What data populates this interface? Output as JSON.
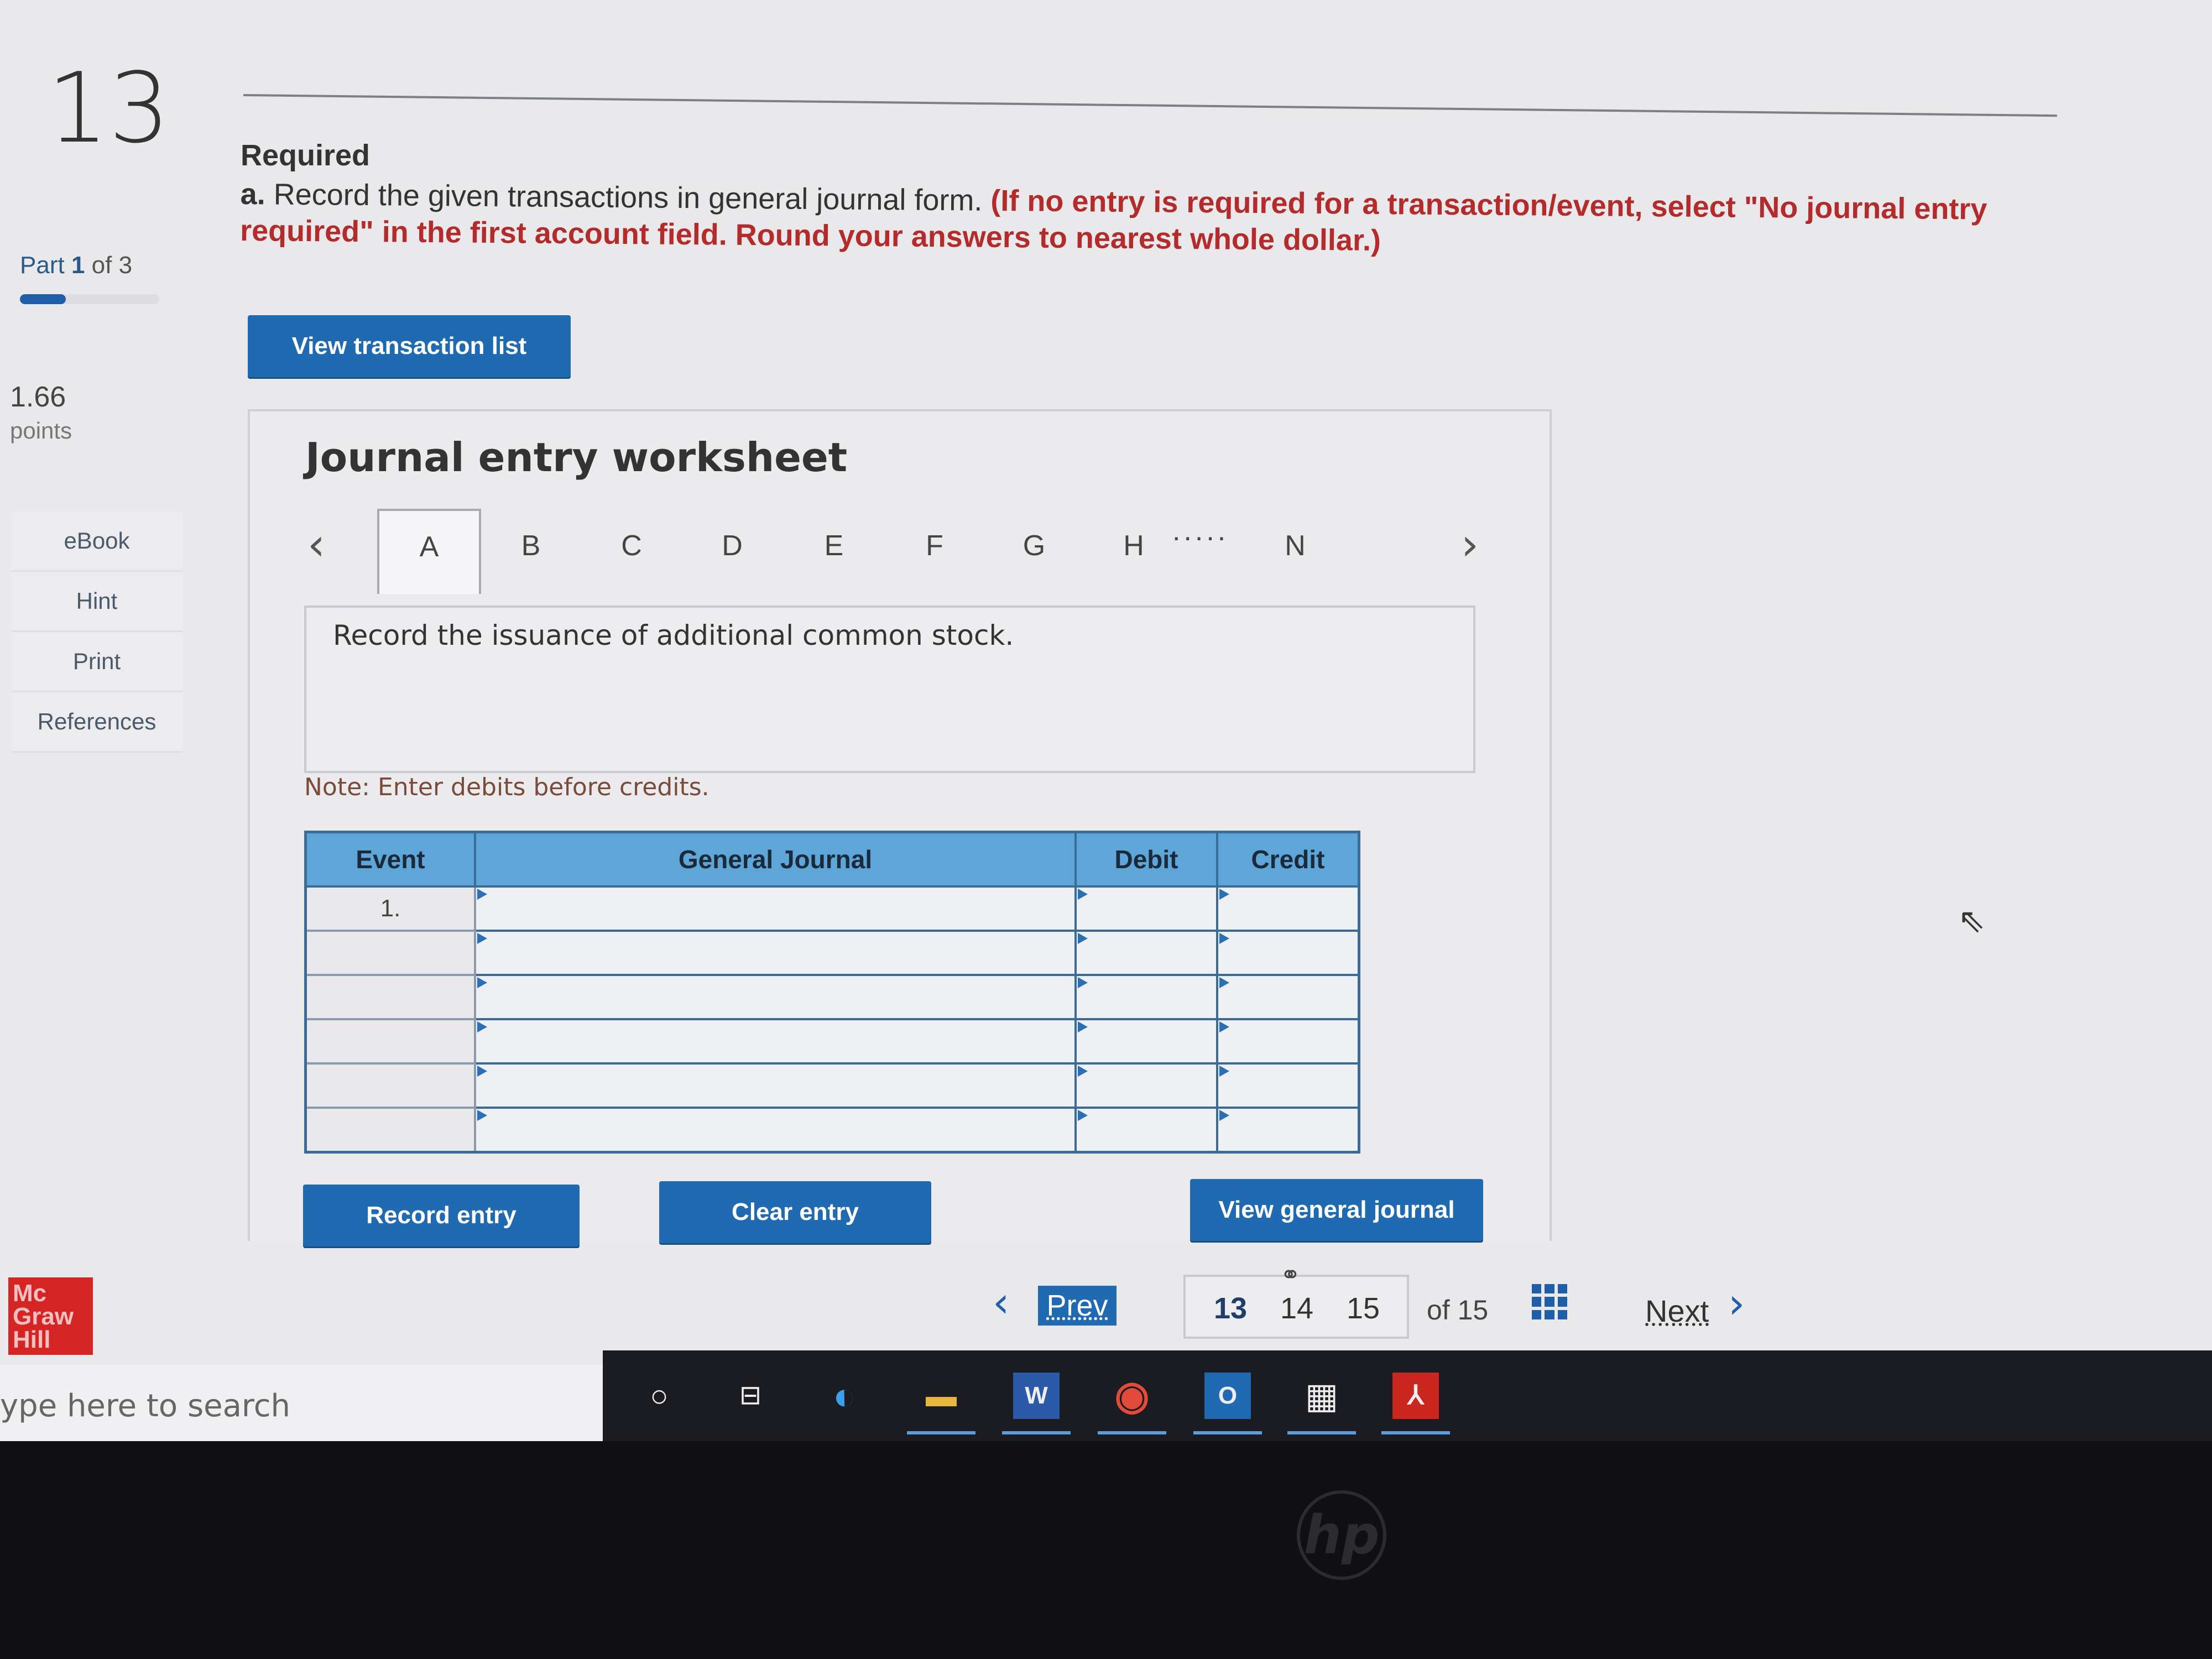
{
  "sidebar": {
    "question_number": "13",
    "part": {
      "label": "Part",
      "current": "1",
      "rest": "of 3",
      "progress_fraction": 0.33
    },
    "points": {
      "value": "1.66",
      "label": "points"
    },
    "nav": [
      "eBook",
      "Hint",
      "Print",
      "References"
    ],
    "logo": [
      "Mc",
      "Graw",
      "Hill"
    ]
  },
  "prompt": {
    "heading": "Required",
    "instruction_lead": "a.",
    "instruction": "Record the given transactions in general journal form.",
    "instruction_note": "(If no entry is required for a transaction/event, select \"No journal entry required\" in the first account field. Round your answers to nearest whole dollar.)",
    "view_transaction_button": "View transaction list"
  },
  "worksheet": {
    "title": "Journal entry worksheet",
    "tabs": [
      "A",
      "B",
      "C",
      "D",
      "E",
      "F",
      "G",
      "H",
      "N"
    ],
    "ellipsis": ".....",
    "active_tab": "A",
    "description": "Record the issuance of additional common stock.",
    "note": "Note: Enter debits before credits.",
    "table": {
      "headers": [
        "Event",
        "General Journal",
        "Debit",
        "Credit"
      ],
      "rows": [
        {
          "event": "1."
        },
        {
          "event": ""
        },
        {
          "event": ""
        },
        {
          "event": ""
        },
        {
          "event": ""
        },
        {
          "event": ""
        }
      ]
    },
    "buttons": {
      "record": "Record entry",
      "clear": "Clear entry",
      "view_journal": "View general journal"
    }
  },
  "pagination": {
    "prev": "Prev",
    "pages": [
      "13",
      "14",
      "15"
    ],
    "current": "13",
    "of": "of 15",
    "next": "Next"
  },
  "taskbar": {
    "search_placeholder": "ype here to search",
    "apps": [
      "cortana",
      "task-view",
      "edge",
      "file-explorer",
      "word",
      "chrome",
      "outlook",
      "calculator",
      "acrobat"
    ]
  },
  "bezel": {
    "brand": "hp"
  }
}
